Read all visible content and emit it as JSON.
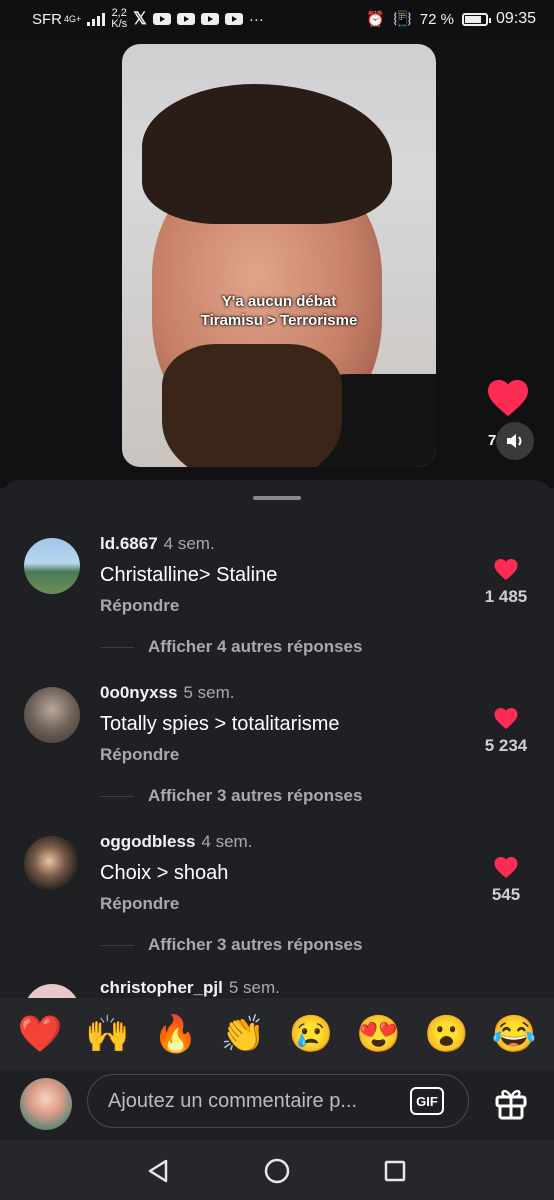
{
  "status_bar": {
    "carrier": "SFR",
    "network_type": "4G+",
    "speed_value": "2,2",
    "speed_unit": "K/s",
    "battery_percent": "72 %",
    "battery_level": 0.72,
    "time": "09:35"
  },
  "video": {
    "caption_line1": "Y'a aucun débat",
    "caption_line2": "Tiramisu > Terrorisme",
    "like_count_partial": "7"
  },
  "comments": [
    {
      "username": "ld.6867",
      "age": "4 sem.",
      "text": "Christalline> Staline",
      "reply_label": "Répondre",
      "likes": "1 485",
      "more_replies": "Afficher 4 autres réponses"
    },
    {
      "username": "0o0nyxss",
      "age": "5 sem.",
      "text": "Totally spies > totalitarisme",
      "reply_label": "Répondre",
      "likes": "5 234",
      "more_replies": "Afficher 3 autres réponses"
    },
    {
      "username": "oggodbless",
      "age": "4 sem.",
      "text": "Choix > shoah",
      "reply_label": "Répondre",
      "likes": "545",
      "more_replies": "Afficher 3 autres réponses"
    },
    {
      "username": "christopher_pjl",
      "age": "5 sem."
    }
  ],
  "emoji_bar": [
    "❤️",
    "🙌",
    "🔥",
    "👏",
    "😢",
    "😍",
    "😮",
    "😂"
  ],
  "input": {
    "placeholder": "Ajoutez un commentaire p...",
    "gif_label": "GIF"
  },
  "icons": {
    "heart": "heart-icon",
    "sound": "sound-icon",
    "gift": "gift-icon",
    "back": "back-icon",
    "home": "home-icon",
    "recents": "recents-icon"
  },
  "colors": {
    "heart": "#fe2c55",
    "sheet_bg": "#1f2023",
    "muted_text": "#a8a8ad"
  }
}
